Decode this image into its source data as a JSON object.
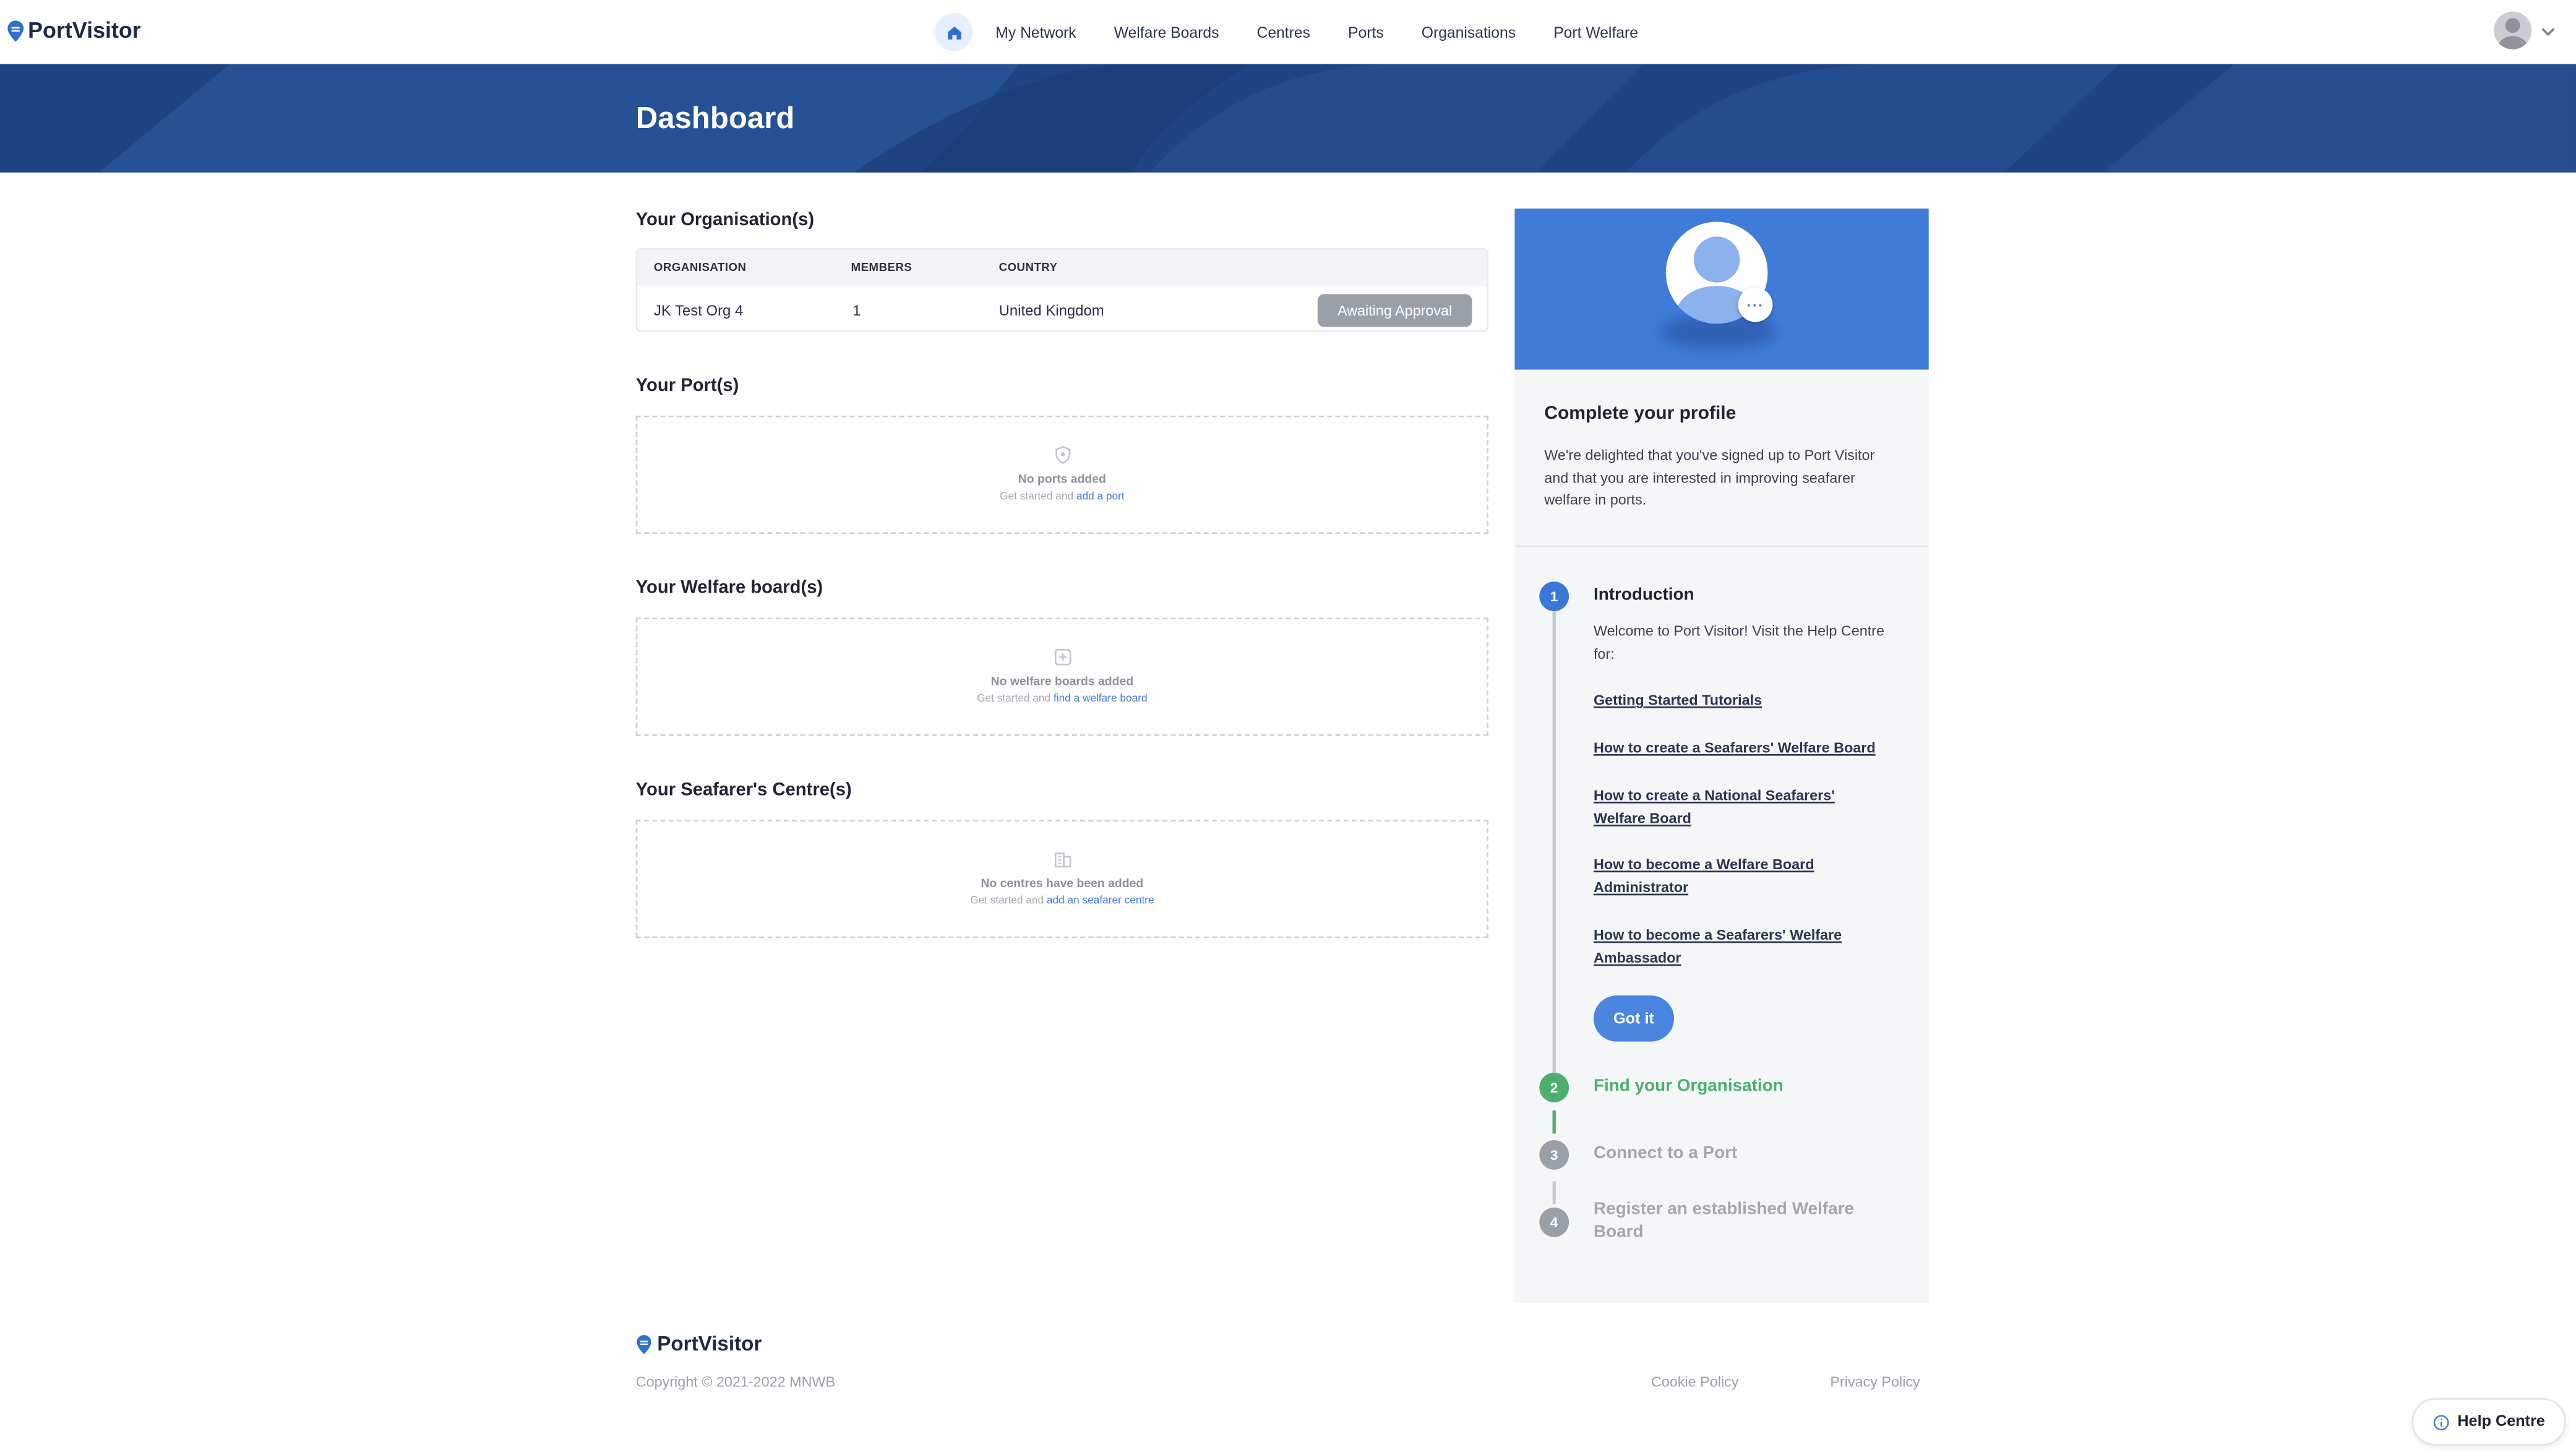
{
  "app": {
    "name": "PortVisitor"
  },
  "nav": {
    "home_icon": "home-icon",
    "links": [
      "My Network",
      "Welfare Boards",
      "Centres",
      "Ports",
      "Organisations",
      "Port Welfare"
    ]
  },
  "user_menu": {
    "avatar_icon": "user-avatar-icon",
    "chevron_icon": "chevron-down-icon"
  },
  "hero": {
    "title": "Dashboard"
  },
  "organisations": {
    "title": "Your Organisation(s)",
    "columns": [
      "ORGANISATION",
      "MEMBERS",
      "COUNTRY"
    ],
    "rows": [
      {
        "name": "JK Test Org 4",
        "members": "1",
        "country": "United Kingdom",
        "status": "Awaiting Approval"
      }
    ]
  },
  "ports": {
    "title": "Your Port(s)",
    "empty_icon": "shield-icon",
    "empty_title": "No ports added",
    "empty_prefix": "Get started and",
    "empty_link": "add a port"
  },
  "welfare_boards": {
    "title": "Your Welfare board(s)",
    "empty_icon": "add-square-icon",
    "empty_title": "No welfare boards added",
    "empty_prefix": "Get started and",
    "empty_link": "find a welfare board"
  },
  "centres": {
    "title": "Your Seafarer's Centre(s)",
    "empty_icon": "building-icon",
    "empty_title": "No centres have been added",
    "empty_prefix": "Get started and",
    "empty_link": "add an seafarer centre"
  },
  "profile": {
    "title": "Complete your profile",
    "intro": "We're delighted that you've signed up to Port Visitor and that you are interested in improving seafarer welfare in ports.",
    "avatar_menu": "···",
    "steps": [
      {
        "number": "1",
        "title": "Introduction",
        "text": "Welcome to Port Visitor! Visit the Help Centre for:",
        "links": [
          "Getting Started Tutorials",
          "How to create a Seafarers' Welfare Board",
          "How to create a National Seafarers' Welfare Board",
          "How to become a Welfare Board Administrator",
          "How to become a Seafarers' Welfare Ambassador"
        ],
        "button": "Got it"
      },
      {
        "number": "2",
        "title": "Find your Organisation"
      },
      {
        "number": "3",
        "title": "Connect to a Port"
      },
      {
        "number": "4",
        "title": "Register an established Welfare Board"
      }
    ]
  },
  "footer": {
    "copyright": "Copyright © 2021-2022 MNWB",
    "links": [
      "Cookie Policy",
      "Privacy Policy"
    ],
    "help_centre": "Help Centre",
    "help_icon": "info-icon"
  },
  "colors": {
    "brand_blue": "#1f4484",
    "accent_blue": "#3f7bd9",
    "step_active": "#3a78d8",
    "step_green": "#4caf6e",
    "step_inactive": "#9aa0a9"
  }
}
